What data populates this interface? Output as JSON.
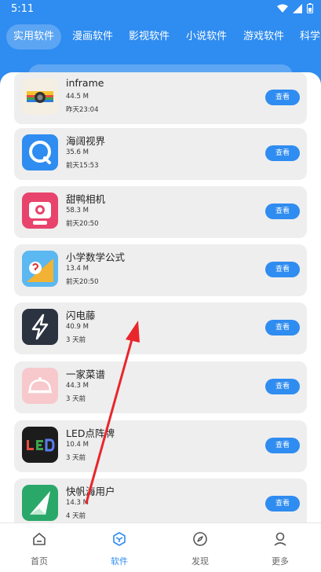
{
  "status": {
    "time": "5:11"
  },
  "tabs": [
    {
      "label": "实用软件",
      "active": true
    },
    {
      "label": "漫画软件"
    },
    {
      "label": "影视软件"
    },
    {
      "label": "小说软件"
    },
    {
      "label": "游戏软件"
    },
    {
      "label": "科学"
    }
  ],
  "apps": [
    {
      "name": "inframe",
      "size": "44.5 M",
      "time": "昨天23:04",
      "button": "查看",
      "icon": "camera-rainbow-icon"
    },
    {
      "name": "海阔视界",
      "size": "35.6 M",
      "time": "前天15:53",
      "button": "查看",
      "icon": "chat-bubble-q-icon"
    },
    {
      "name": "甜鸭相机",
      "size": "58.3 M",
      "time": "前天20:50",
      "button": "查看",
      "icon": "camera-pink-icon"
    },
    {
      "name": "小学数学公式",
      "size": "13.4 M",
      "time": "前天20:50",
      "button": "查看",
      "icon": "math-triangle-icon"
    },
    {
      "name": "闪电藤",
      "size": "40.9 M",
      "time": "3 天前",
      "button": "查看",
      "icon": "lightning-icon"
    },
    {
      "name": "一家菜谱",
      "size": "44.3 M",
      "time": "3 天前",
      "button": "查看",
      "icon": "food-cloche-icon"
    },
    {
      "name": "LED点阵牌",
      "size": "10.4 M",
      "time": "3 天前",
      "button": "查看",
      "icon": "led-board-icon"
    },
    {
      "name": "快帆海用户",
      "size": "14.3 M",
      "time": "4 天前",
      "button": "查看",
      "icon": "sail-icon"
    }
  ],
  "nav": [
    {
      "label": "首页",
      "icon": "home-icon"
    },
    {
      "label": "软件",
      "icon": "cube-icon",
      "active": true
    },
    {
      "label": "发现",
      "icon": "compass-icon"
    },
    {
      "label": "更多",
      "icon": "user-icon"
    }
  ],
  "colors": {
    "accent": "#2f8cf0",
    "annotation": "#e8262b"
  }
}
